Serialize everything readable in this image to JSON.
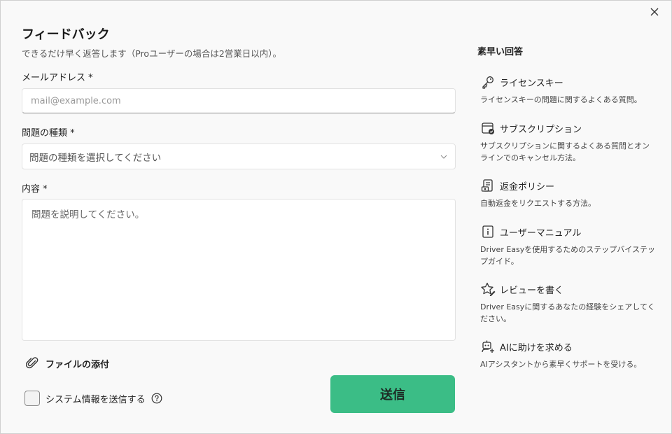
{
  "dialog": {
    "title": "フィードバック",
    "subtitle": "できるだけ早く返答します（Proユーザーの場合は2営業日以内）。"
  },
  "form": {
    "email_label": "メールアドレス *",
    "email_placeholder": "mail@example.com",
    "type_label": "問題の種類 *",
    "type_selected": "問題の種類を選択してください",
    "content_label": "内容 *",
    "content_placeholder": "問題を説明してください。",
    "attach_label": "ファイルの添付",
    "sysinfo_label": "システム情報を送信する",
    "submit_label": "送信"
  },
  "sidebar": {
    "title": "素早い回答",
    "items": [
      {
        "icon": "key-icon",
        "label": "ライセンスキー",
        "desc": "ライセンスキーの問題に関するよくある質問。"
      },
      {
        "icon": "subscription-icon",
        "label": "サブスクリプション",
        "desc": "サブスクリプションに関するよくある質問とオンラインでのキャンセル方法。"
      },
      {
        "icon": "refund-icon",
        "label": "返金ポリシー",
        "desc": "自動返金をリクエストする方法。"
      },
      {
        "icon": "manual-icon",
        "label": "ユーザーマニュアル",
        "desc": "Driver Easyを使用するためのステップバイステップガイド。"
      },
      {
        "icon": "star-pen-icon",
        "label": "レビューを書く",
        "desc": "Driver Easyに関するあなたの経験をシェアしてください。"
      },
      {
        "icon": "ai-robot-icon",
        "label": "AIに助けを求める",
        "desc": "AIアシスタントから素早くサポートを受ける。"
      }
    ]
  },
  "colors": {
    "accent": "#3bbd86",
    "background": "#f9f9f9"
  }
}
